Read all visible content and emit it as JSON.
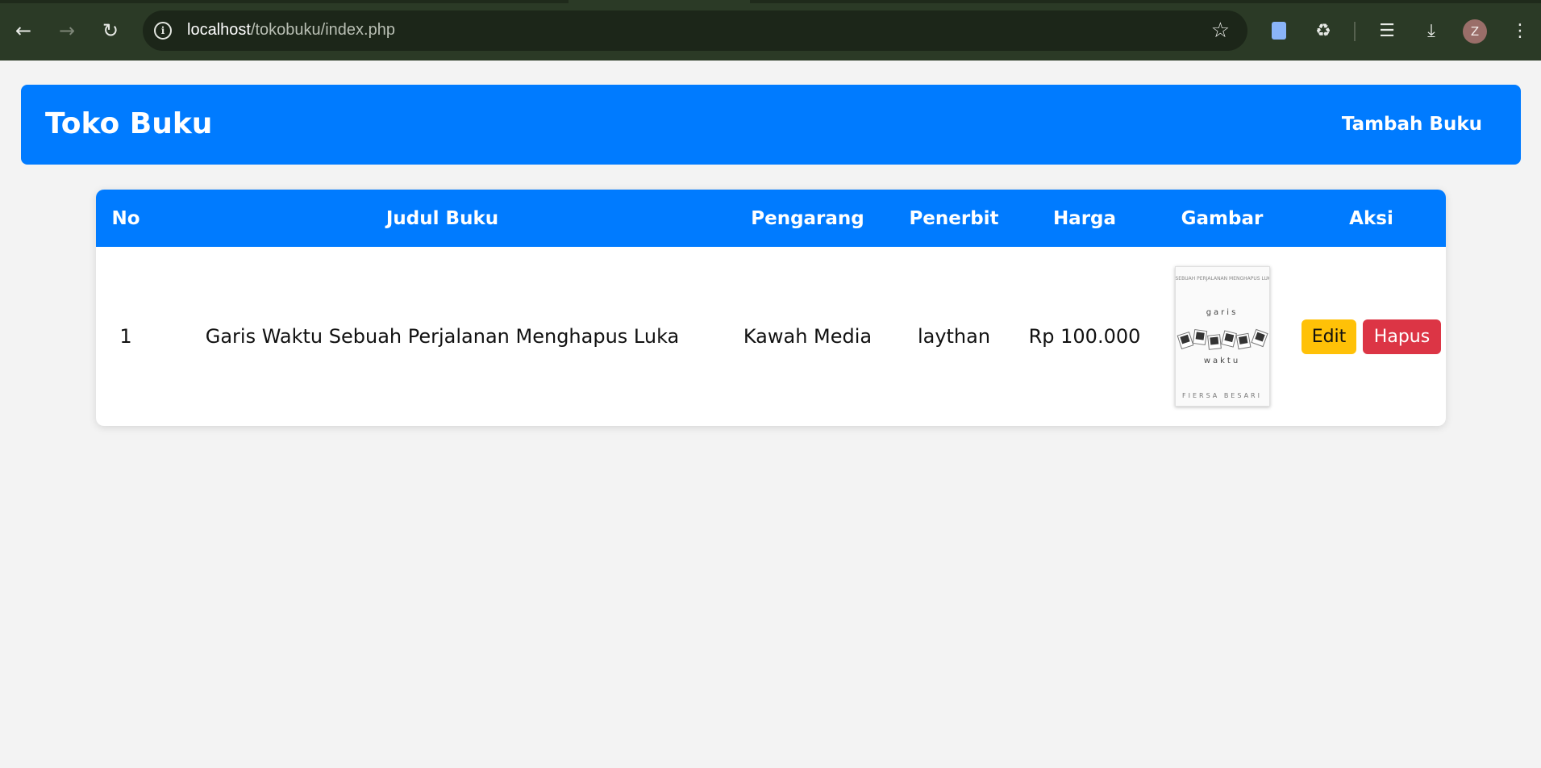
{
  "browser": {
    "url_host": "localhost",
    "url_path": "/tokobuku/index.php",
    "profile_initial": "Z"
  },
  "header": {
    "title": "Toko Buku",
    "nav_add": "Tambah Buku"
  },
  "table": {
    "columns": [
      "No",
      "Judul Buku",
      "Pengarang",
      "Penerbit",
      "Harga",
      "Gambar",
      "Aksi"
    ],
    "rows": [
      {
        "no": "1",
        "judul": "Garis Waktu Sebuah Perjalanan Menghapus Luka",
        "pengarang": "Kawah Media",
        "penerbit": "laythan",
        "harga": "Rp 100.000",
        "cover": {
          "top_text": "SEBUAH PERJALANAN MENGHAPUS LUKA",
          "word1": "garis",
          "word2": "waktu",
          "author": "FIERSA BESARI"
        },
        "edit_label": "Edit",
        "delete_label": "Hapus"
      }
    ]
  },
  "colors": {
    "primary": "#007bff",
    "edit": "#ffc107",
    "delete": "#dc3545",
    "background": "#f3f3f3"
  }
}
